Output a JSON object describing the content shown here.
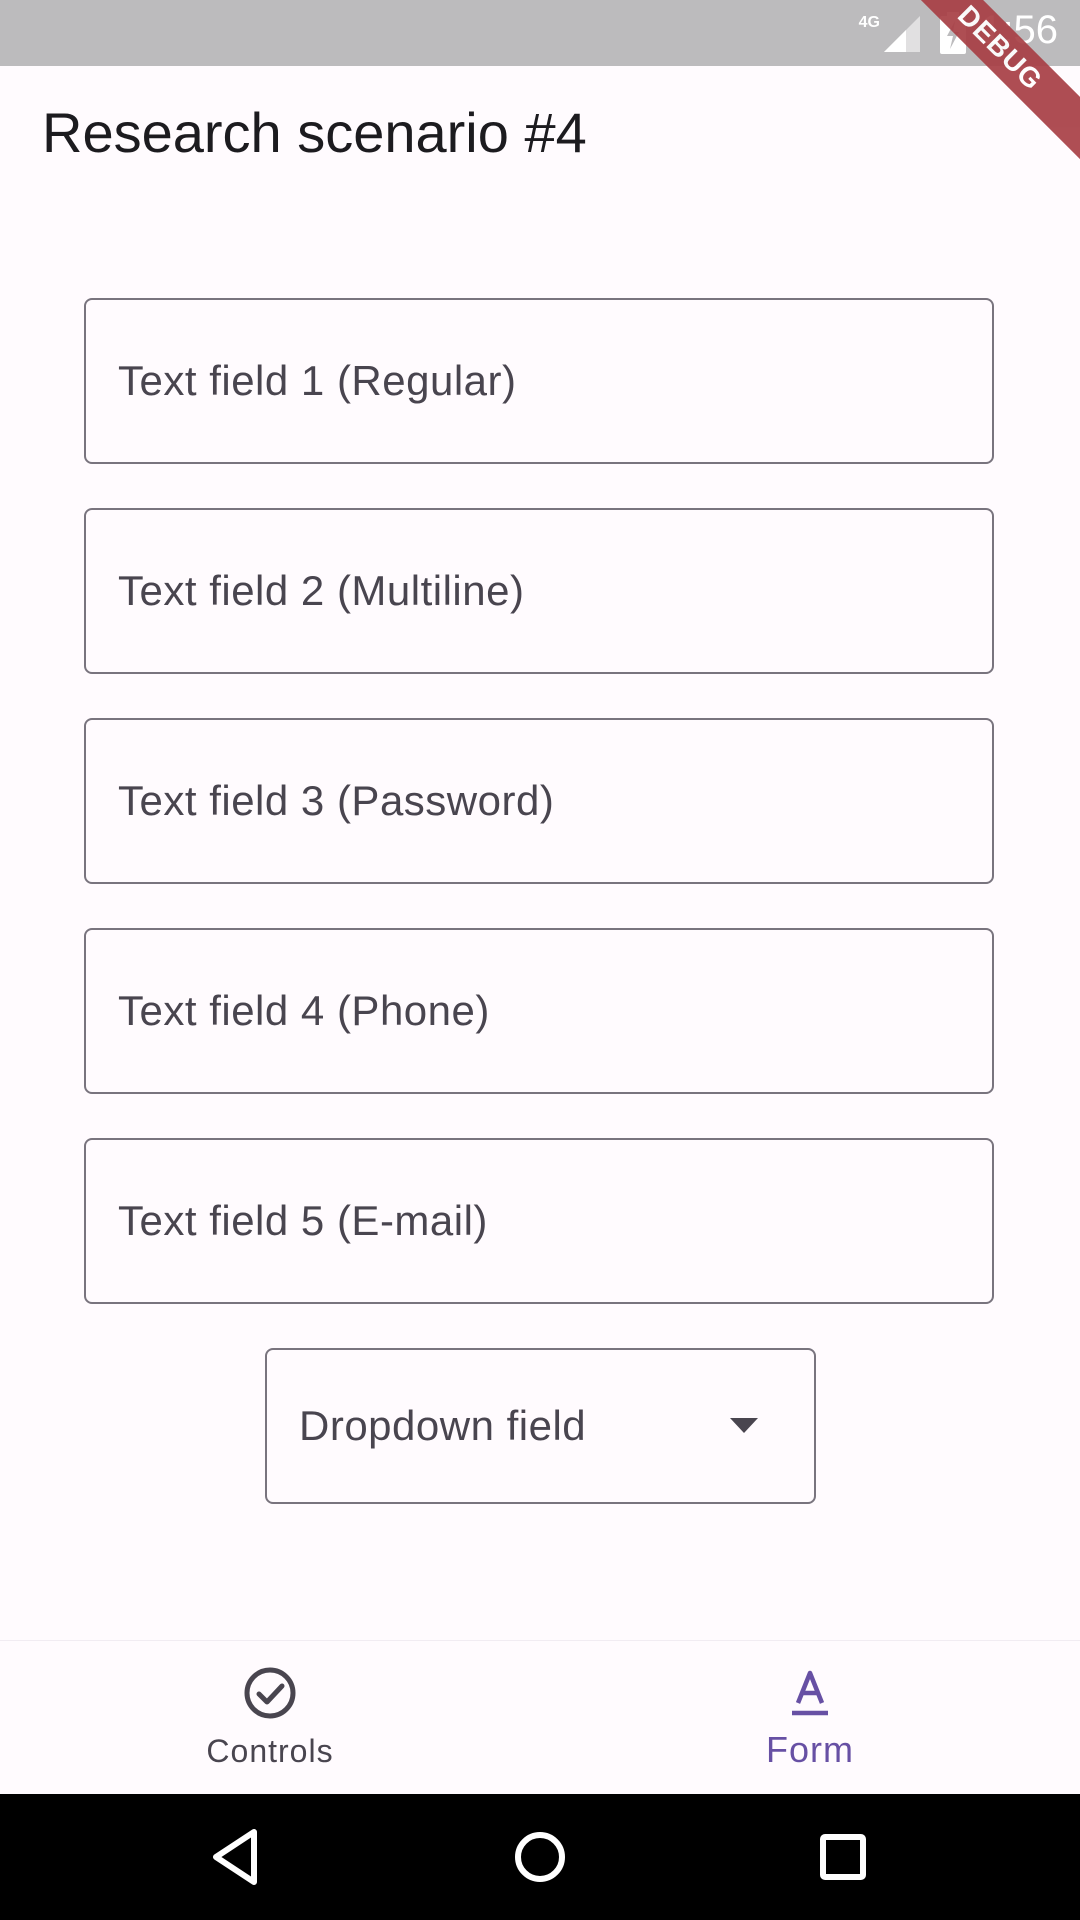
{
  "status_bar": {
    "time": "1:56",
    "network": "4G",
    "debug_banner": "DEBUG"
  },
  "header": {
    "title": "Research scenario #4"
  },
  "form": {
    "fields": [
      {
        "label": "Text field 1 (Regular)"
      },
      {
        "label": "Text field 2 (Multiline)"
      },
      {
        "label": "Text field 3 (Password)"
      },
      {
        "label": "Text field 4 (Phone)"
      },
      {
        "label": "Text field 5 (E-mail)"
      }
    ],
    "dropdown": {
      "label": "Dropdown field"
    }
  },
  "bottom_nav": {
    "items": [
      {
        "label": "Controls",
        "icon": "check-circle-icon",
        "selected": false
      },
      {
        "label": "Form",
        "icon": "text-format-icon",
        "selected": true
      }
    ]
  },
  "colors": {
    "accent": "#6750a4",
    "outline": "#79747e",
    "label": "#49454f",
    "background": "#fffbfe",
    "status_bar": "#bcbbbd",
    "debug_ribbon": "#a83f45"
  }
}
